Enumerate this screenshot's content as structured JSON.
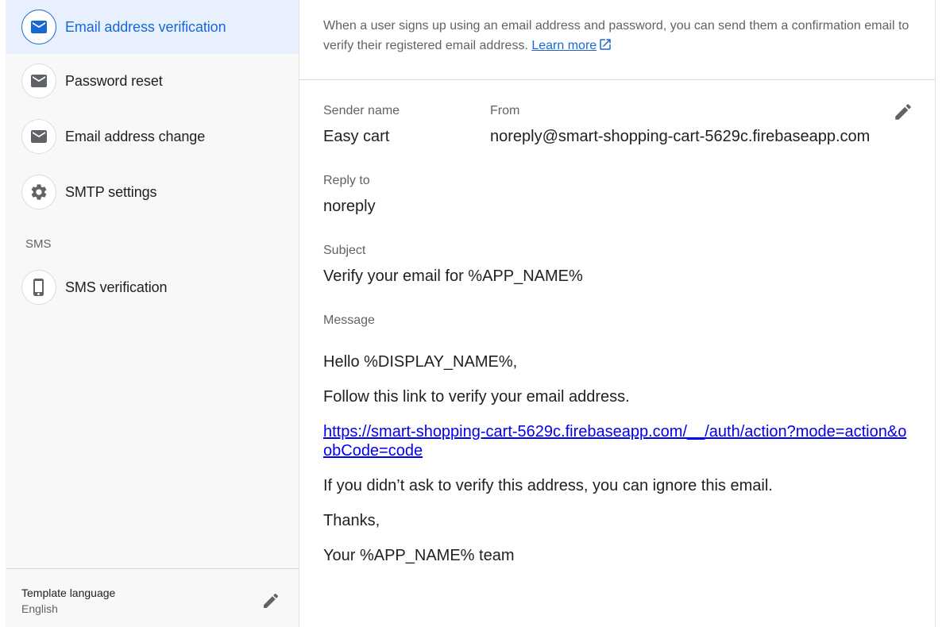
{
  "sidebar": {
    "items": [
      {
        "label": "Email address verification",
        "icon": "email-icon",
        "active": true
      },
      {
        "label": "Password reset",
        "icon": "email-icon"
      },
      {
        "label": "Email address change",
        "icon": "email-icon"
      },
      {
        "label": "SMTP settings",
        "icon": "gear-icon"
      }
    ],
    "sms_section_label": "SMS",
    "sms_item": {
      "label": "SMS verification",
      "icon": "phone-icon"
    },
    "template_language": {
      "title": "Template language",
      "value": "English"
    }
  },
  "main": {
    "description": "When a user signs up using an email address and password, you can send them a confirmation email to verify their registered email address.",
    "learn_more": "Learn more",
    "sender_name_label": "Sender name",
    "sender_name_value": "Easy cart",
    "from_label": "From",
    "from_value": "noreply@smart-shopping-cart-5629c.firebaseapp.com",
    "reply_to_label": "Reply to",
    "reply_to_value": "noreply",
    "subject_label": "Subject",
    "subject_value": "Verify your email for %APP_NAME%",
    "message_label": "Message",
    "message": {
      "greeting": "Hello %DISPLAY_NAME%,",
      "instruction": "Follow this link to verify your email address.",
      "link": "https://smart-shopping-cart-5629c.firebaseapp.com/__/auth/action?mode=action&oobCode=code",
      "ignore_note": "If you didn’t ask to verify this address, you can ignore this email.",
      "thanks": "Thanks,",
      "signature": "Your %APP_NAME% team"
    }
  },
  "colors": {
    "accent": "#1967d2",
    "active_bg": "#e8f0fe",
    "link": "#0000ee",
    "icon_gray": "#5f6368"
  }
}
